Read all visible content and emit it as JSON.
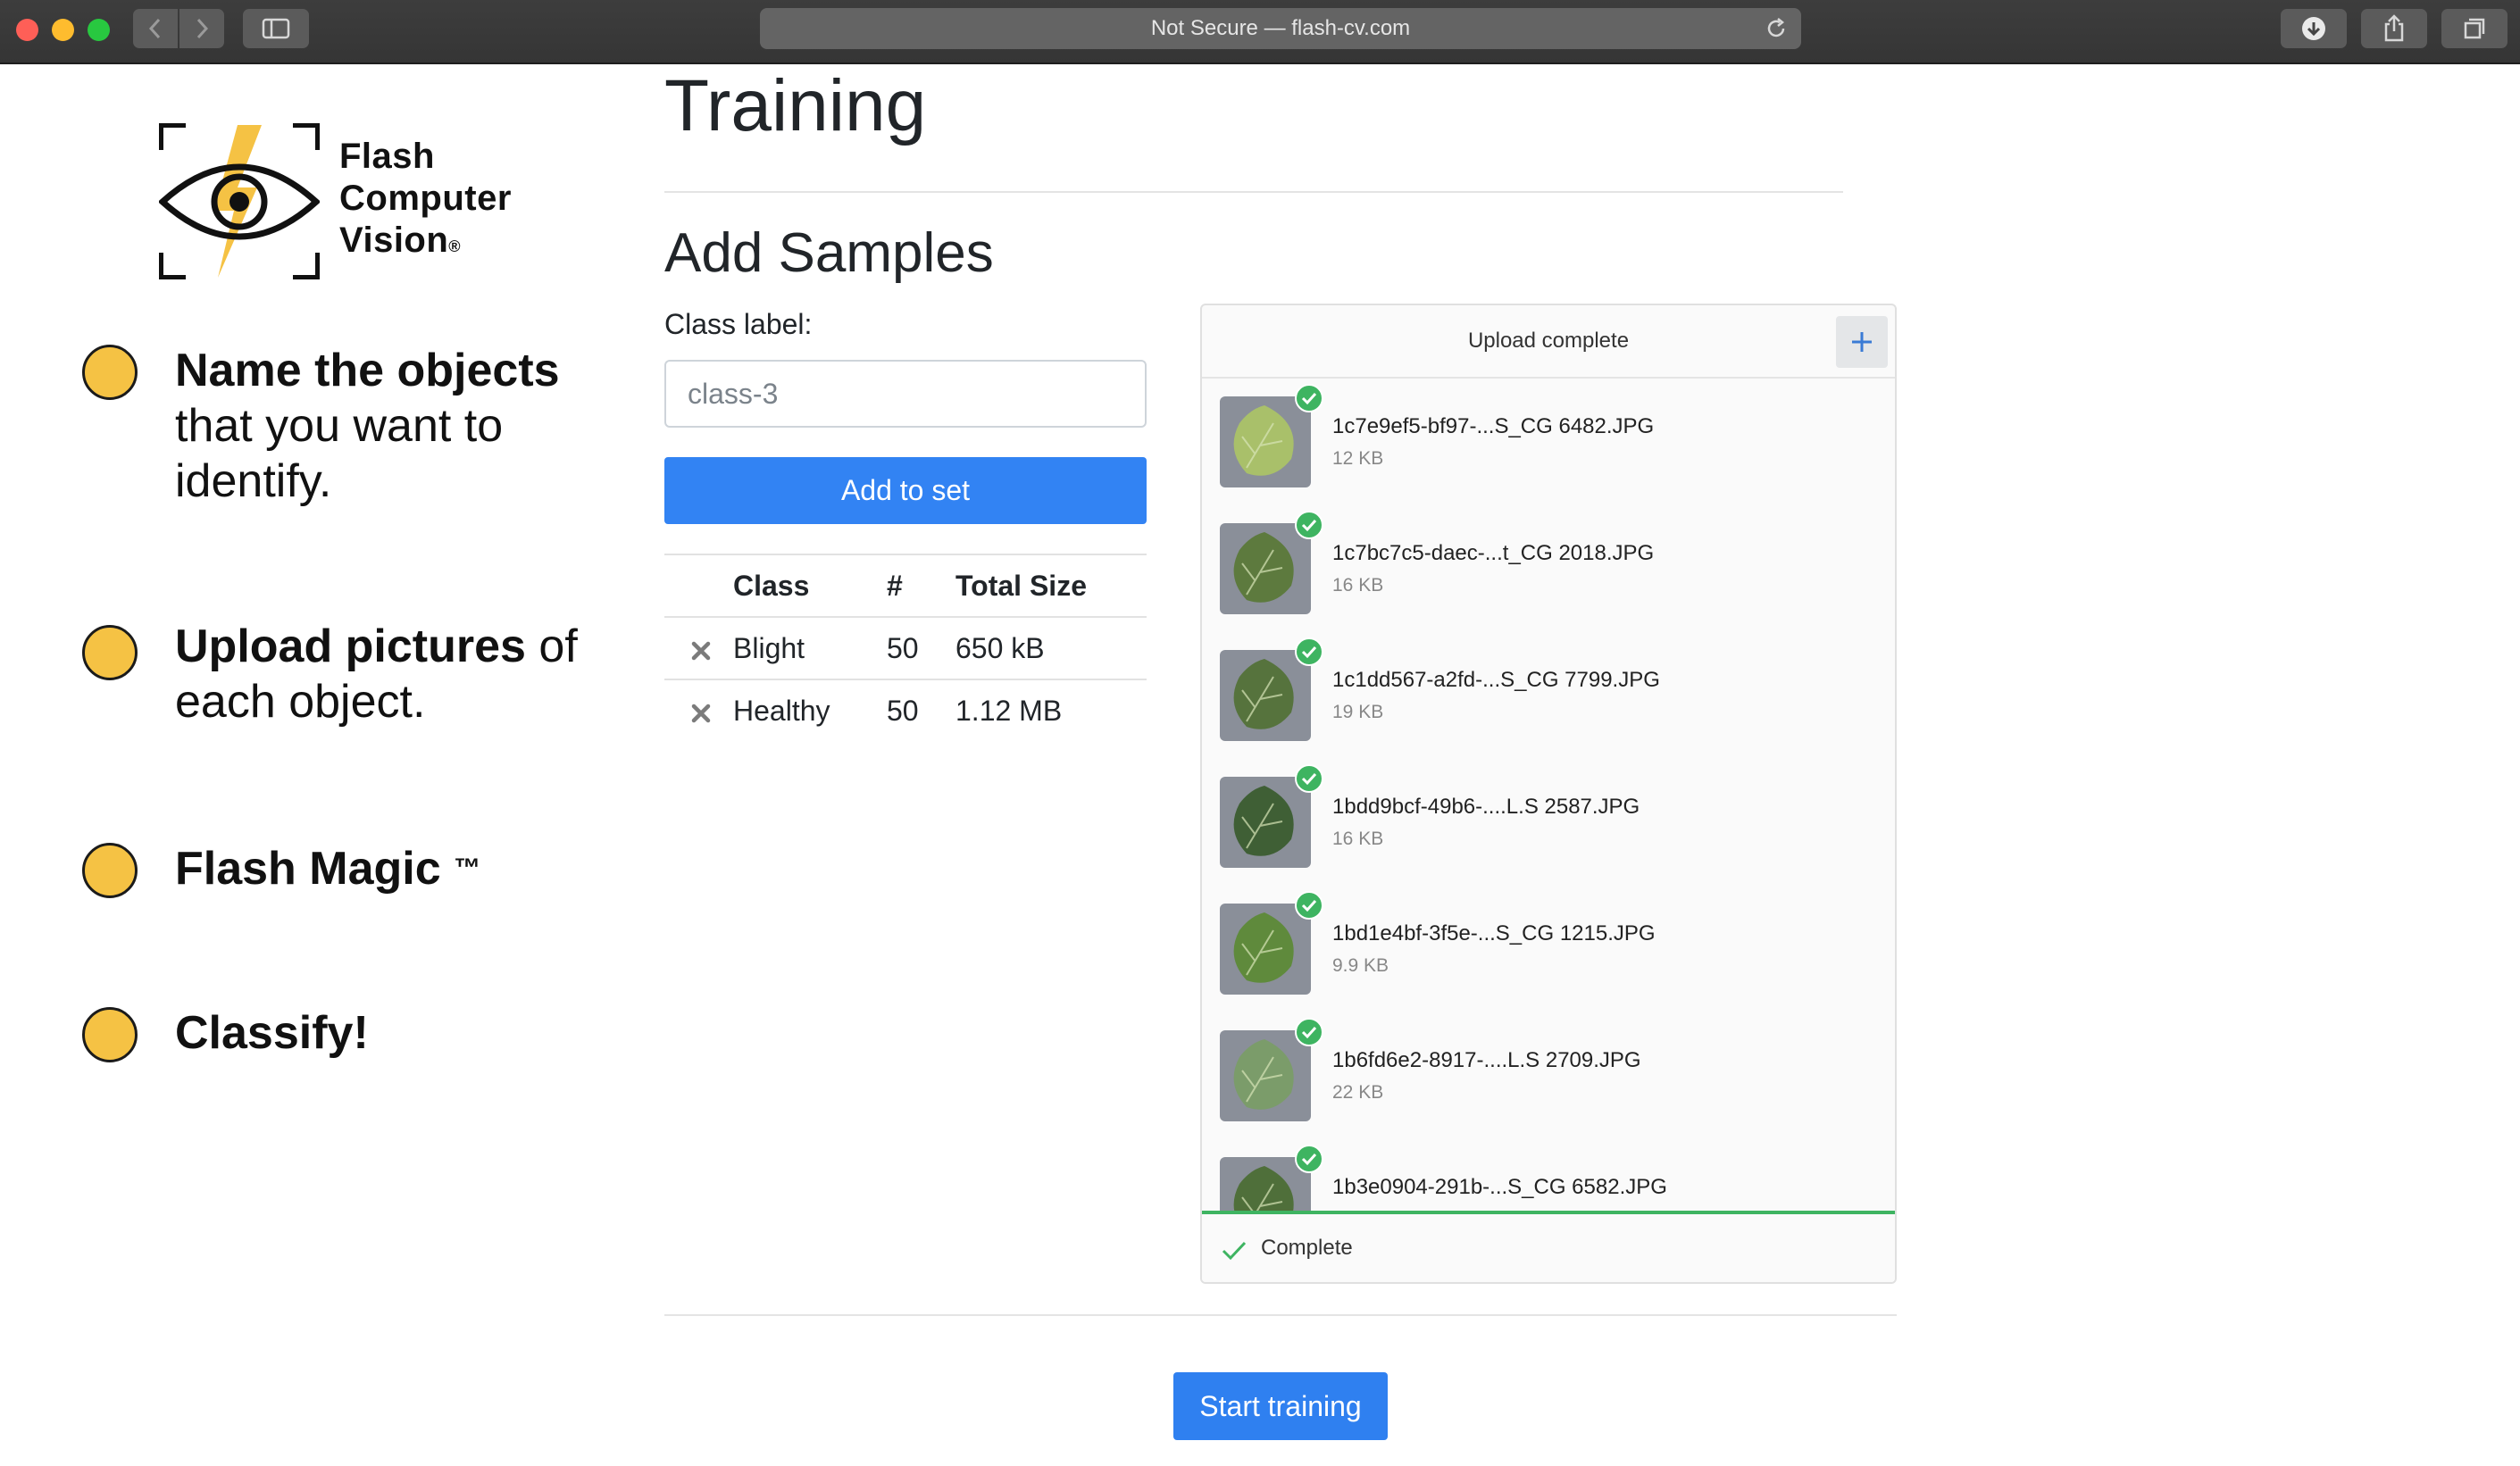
{
  "browser": {
    "url_text": "Not Secure — flash-cv.com"
  },
  "logo": {
    "line1": "Flash",
    "line2": "Computer",
    "line3": "Vision",
    "reg": "®"
  },
  "steps": [
    {
      "bold": "Name the objects",
      "rest": "that you want to identify."
    },
    {
      "bold": "Upload pictures",
      "rest": "of each object."
    },
    {
      "bold": "Flash Magic",
      "tm": "™"
    },
    {
      "bold": "Classify!"
    }
  ],
  "main": {
    "title": "Training",
    "add_samples": "Add Samples",
    "class_label": "Class label:",
    "class_placeholder": "class-3",
    "add_button": "Add to set",
    "start_button": "Start training"
  },
  "classes_table": {
    "headers": [
      "Class",
      "#",
      "Total Size"
    ],
    "rows": [
      {
        "name": "Blight",
        "count": "50",
        "size": "650 kB"
      },
      {
        "name": "Healthy",
        "count": "50",
        "size": "1.12 MB"
      }
    ]
  },
  "upload": {
    "header": "Upload complete",
    "footer": "Complete",
    "files": [
      {
        "name": "1c7e9ef5-bf97-...S_CG 6482.JPG",
        "size": "12 KB",
        "color": "#a9c06a"
      },
      {
        "name": "1c7bc7c5-daec-...t_CG 2018.JPG",
        "size": "16 KB",
        "color": "#5d7a3e"
      },
      {
        "name": "1c1dd567-a2fd-...S_CG 7799.JPG",
        "size": "19 KB",
        "color": "#56733d"
      },
      {
        "name": "1bdd9bcf-49b6-....L.S 2587.JPG",
        "size": "16 KB",
        "color": "#3f5f35"
      },
      {
        "name": "1bd1e4bf-3f5e-...S_CG 1215.JPG",
        "size": "9.9 KB",
        "color": "#5f8a3c"
      },
      {
        "name": "1b6fd6e2-8917-....L.S 2709.JPG",
        "size": "22 KB",
        "color": "#7b9c6a"
      },
      {
        "name": "1b3e0904-291b-...S_CG 6582.JPG",
        "size": "",
        "color": "#4f6f3a"
      }
    ]
  },
  "colors": {
    "primary": "#3283f3",
    "success": "#3eb461",
    "step_dot": "#f5c244"
  }
}
